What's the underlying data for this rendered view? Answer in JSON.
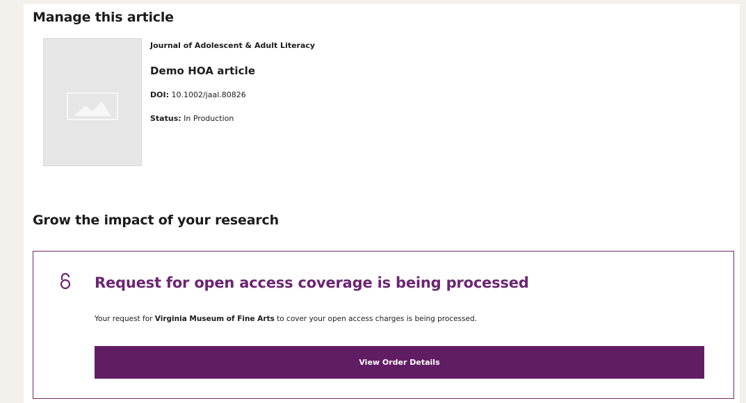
{
  "manage": {
    "title": "Manage this article",
    "thumbnail_icon": "image-placeholder-icon",
    "journal": "Journal of Adolescent & Adult Literacy",
    "article_title": "Demo HOA article",
    "doi_label": "DOI:",
    "doi_value": "10.1002/jaal.80826",
    "status_label": "Status:",
    "status_value": "In Production"
  },
  "impact": {
    "title": "Grow the impact of your research",
    "card": {
      "icon": "open-lock-icon",
      "title": "Request for open access coverage is being processed",
      "text_before": "Your request for ",
      "institution": "Virginia Museum of Fine Arts",
      "text_after": " to cover your open access charges is being processed.",
      "button_label": "View Order Details"
    }
  },
  "colors": {
    "accent": "#6b2572",
    "button_bg": "#611d63",
    "border": "#6b2a6b",
    "page_bg": "#f2f1ec",
    "placeholder_bg": "#e6e6e6"
  }
}
